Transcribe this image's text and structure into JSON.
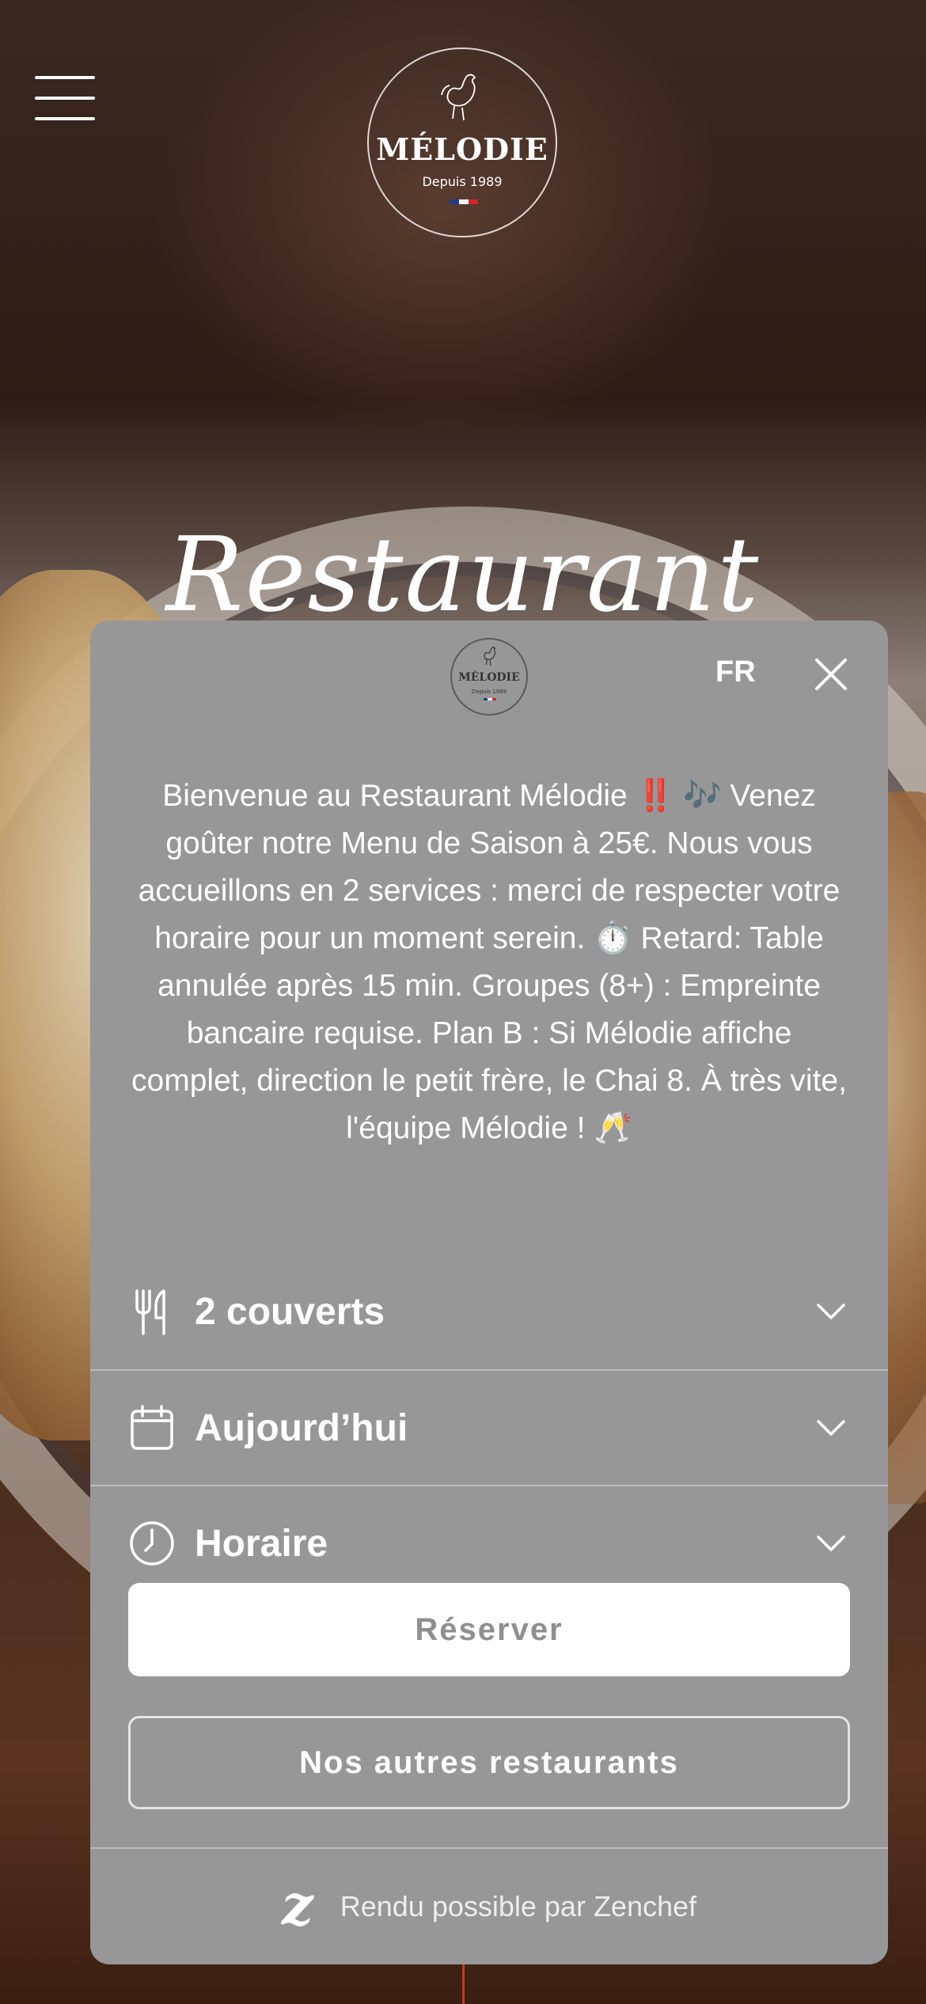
{
  "brand": {
    "name": "MÉLODIE",
    "since": "Depuis 1989",
    "flag_colors": [
      "#1f3c8f",
      "#ffffff",
      "#d3242b"
    ]
  },
  "hero": {
    "title": "Restaurant"
  },
  "icons": {
    "menu": "hamburger-icon",
    "close": "close-icon",
    "guests": "fork-knife-icon",
    "date": "calendar-icon",
    "time": "clock-icon",
    "chevron": "chevron-down-icon",
    "provider": "zenchef-logo-icon"
  },
  "widget": {
    "language": "FR",
    "welcome": "Bienvenue au Restaurant Mélodie ‼️ 🎶 Venez goûter notre Menu de Saison à 25€. Nous vous accueillons en 2 services : merci de respecter votre horaire pour un moment serein. ⏱️ Retard: Table annulée après 15 min. Groupes (8+) : Empreinte bancaire requise. Plan B : Si Mélodie affiche complet, direction le petit frère, le Chai 8. À très vite, l'équipe Mélodie ! 🥂",
    "guests_label": "2 couverts",
    "date_label": "Aujourd’hui",
    "time_label": "Horaire",
    "reserve_button": "Réserver",
    "other_restaurants_button": "Nos autres restaurants",
    "footer_text": "Rendu possible par Zenchef",
    "provider_glyph": "z"
  },
  "colors": {
    "modal_bg": "#979797",
    "reserve_text": "#8f8f8f"
  }
}
